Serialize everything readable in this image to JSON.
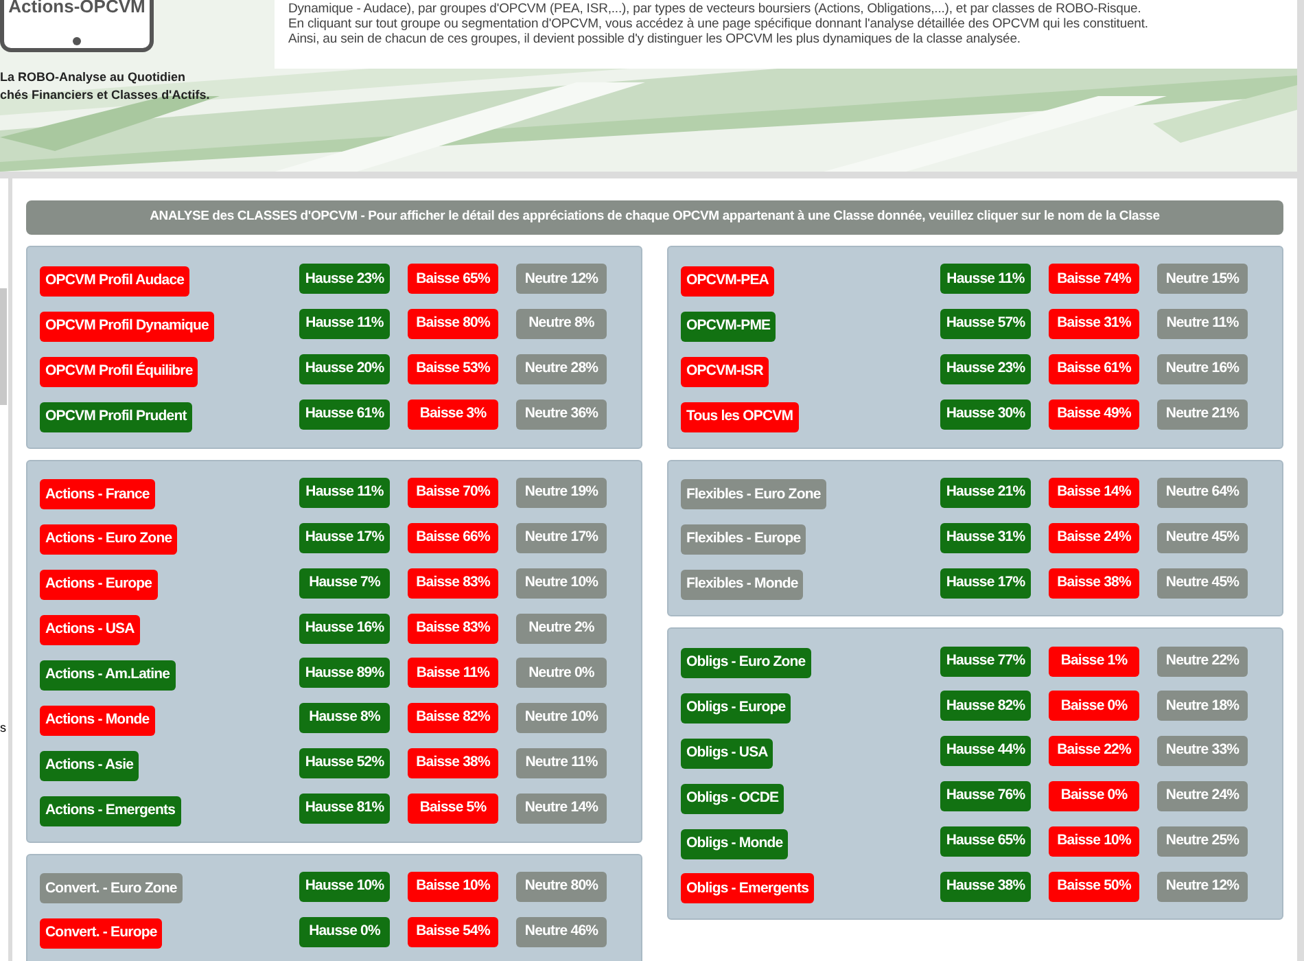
{
  "header": {
    "logo_text": "Actions-OPCVM",
    "tagline": [
      "La ROBO-Analyse au Quotidien",
      "chés Financiers et Classes d'Actifs."
    ],
    "intro": [
      "Dynamique - Audace), par groupes d'OPCVM (PEA, ISR,...), par types de vecteurs boursiers (Actions, Obligations,...), et par classes de ROBO-Risque.",
      "En cliquant sur tout groupe ou segmentation d'OPCVM, vous accédez à une page spécifique donnant l'analyse détaillée des OPCVM qui les constituent.",
      "Ainsi, au sein de chacun de ces groupes, il devient possible d'y distinguer les OPCVM les plus dynamiques de la classe analysée."
    ]
  },
  "sidebar": {
    "text": "s"
  },
  "title": "ANALYSE des CLASSES d'OPCVM - Pour afficher le détail des appréciations de chaque OPCVM appartenant à une Classe donnée, veuillez cliquer sur le nom de la Classe",
  "columns": [
    {
      "groups": [
        {
          "rows": [
            {
              "name": "OPCVM Profil Audace",
              "color": "#ff0000",
              "hausse": "Hausse 23%",
              "baisse": "Baisse 65%",
              "neutre": "Neutre 12%"
            },
            {
              "name": "OPCVM Profil Dynamique",
              "color": "#ff0000",
              "hausse": "Hausse 11%",
              "baisse": "Baisse 80%",
              "neutre": "Neutre 8%"
            },
            {
              "name": "OPCVM Profil Équilibre",
              "color": "#ff0000",
              "hausse": "Hausse 20%",
              "baisse": "Baisse 53%",
              "neutre": "Neutre 28%"
            },
            {
              "name": "OPCVM Profil Prudent",
              "color": "#127212",
              "hausse": "Hausse 61%",
              "baisse": "Baisse 3%",
              "neutre": "Neutre 36%"
            }
          ]
        },
        {
          "rows": [
            {
              "name": "Actions - France",
              "color": "#ff0000",
              "hausse": "Hausse 11%",
              "baisse": "Baisse 70%",
              "neutre": "Neutre 19%"
            },
            {
              "name": "Actions - Euro Zone",
              "color": "#ff0000",
              "hausse": "Hausse 17%",
              "baisse": "Baisse 66%",
              "neutre": "Neutre 17%"
            },
            {
              "name": "Actions - Europe",
              "color": "#ff0000",
              "hausse": "Hausse 7%",
              "baisse": "Baisse 83%",
              "neutre": "Neutre 10%"
            },
            {
              "name": "Actions - USA",
              "color": "#ff0000",
              "hausse": "Hausse 16%",
              "baisse": "Baisse 83%",
              "neutre": "Neutre 2%"
            },
            {
              "name": "Actions - Am.Latine",
              "color": "#127212",
              "hausse": "Hausse 89%",
              "baisse": "Baisse 11%",
              "neutre": "Neutre 0%"
            },
            {
              "name": "Actions - Monde",
              "color": "#ff0000",
              "hausse": "Hausse 8%",
              "baisse": "Baisse 82%",
              "neutre": "Neutre 10%"
            },
            {
              "name": "Actions - Asie",
              "color": "#127212",
              "hausse": "Hausse 52%",
              "baisse": "Baisse 38%",
              "neutre": "Neutre 11%"
            },
            {
              "name": "Actions - Emergents",
              "color": "#127212",
              "hausse": "Hausse 81%",
              "baisse": "Baisse 5%",
              "neutre": "Neutre 14%"
            }
          ]
        },
        {
          "rows": [
            {
              "name": "Convert. - Euro Zone",
              "color": "#878e88",
              "hausse": "Hausse 10%",
              "baisse": "Baisse 10%",
              "neutre": "Neutre 80%"
            },
            {
              "name": "Convert. - Europe",
              "color": "#ff0000",
              "hausse": "Hausse 0%",
              "baisse": "Baisse 54%",
              "neutre": "Neutre 46%"
            }
          ]
        }
      ]
    },
    {
      "groups": [
        {
          "rows": [
            {
              "name": "OPCVM-PEA",
              "color": "#ff0000",
              "hausse": "Hausse 11%",
              "baisse": "Baisse 74%",
              "neutre": "Neutre 15%"
            },
            {
              "name": "OPCVM-PME",
              "color": "#127212",
              "hausse": "Hausse 57%",
              "baisse": "Baisse 31%",
              "neutre": "Neutre 11%"
            },
            {
              "name": "OPCVM-ISR",
              "color": "#ff0000",
              "hausse": "Hausse 23%",
              "baisse": "Baisse 61%",
              "neutre": "Neutre 16%"
            },
            {
              "name": "Tous les OPCVM",
              "color": "#ff0000",
              "hausse": "Hausse 30%",
              "baisse": "Baisse 49%",
              "neutre": "Neutre 21%"
            }
          ]
        },
        {
          "rows": [
            {
              "name": "Flexibles - Euro Zone",
              "color": "#878e88",
              "hausse": "Hausse 21%",
              "baisse": "Baisse 14%",
              "neutre": "Neutre 64%"
            },
            {
              "name": "Flexibles - Europe",
              "color": "#878e88",
              "hausse": "Hausse 31%",
              "baisse": "Baisse 24%",
              "neutre": "Neutre 45%"
            },
            {
              "name": "Flexibles - Monde",
              "color": "#878e88",
              "hausse": "Hausse 17%",
              "baisse": "Baisse 38%",
              "neutre": "Neutre 45%"
            }
          ]
        },
        {
          "rows": [
            {
              "name": "Obligs - Euro Zone",
              "color": "#127212",
              "hausse": "Hausse 77%",
              "baisse": "Baisse 1%",
              "neutre": "Neutre 22%"
            },
            {
              "name": "Obligs - Europe",
              "color": "#127212",
              "hausse": "Hausse 82%",
              "baisse": "Baisse 0%",
              "neutre": "Neutre 18%"
            },
            {
              "name": "Obligs - USA",
              "color": "#127212",
              "hausse": "Hausse 44%",
              "baisse": "Baisse 22%",
              "neutre": "Neutre 33%"
            },
            {
              "name": "Obligs - OCDE",
              "color": "#127212",
              "hausse": "Hausse 76%",
              "baisse": "Baisse 0%",
              "neutre": "Neutre 24%"
            },
            {
              "name": "Obligs - Monde",
              "color": "#127212",
              "hausse": "Hausse 65%",
              "baisse": "Baisse 10%",
              "neutre": "Neutre 25%"
            },
            {
              "name": "Obligs - Emergents",
              "color": "#ff0000",
              "hausse": "Hausse 38%",
              "baisse": "Baisse 50%",
              "neutre": "Neutre 12%"
            }
          ]
        }
      ]
    }
  ]
}
